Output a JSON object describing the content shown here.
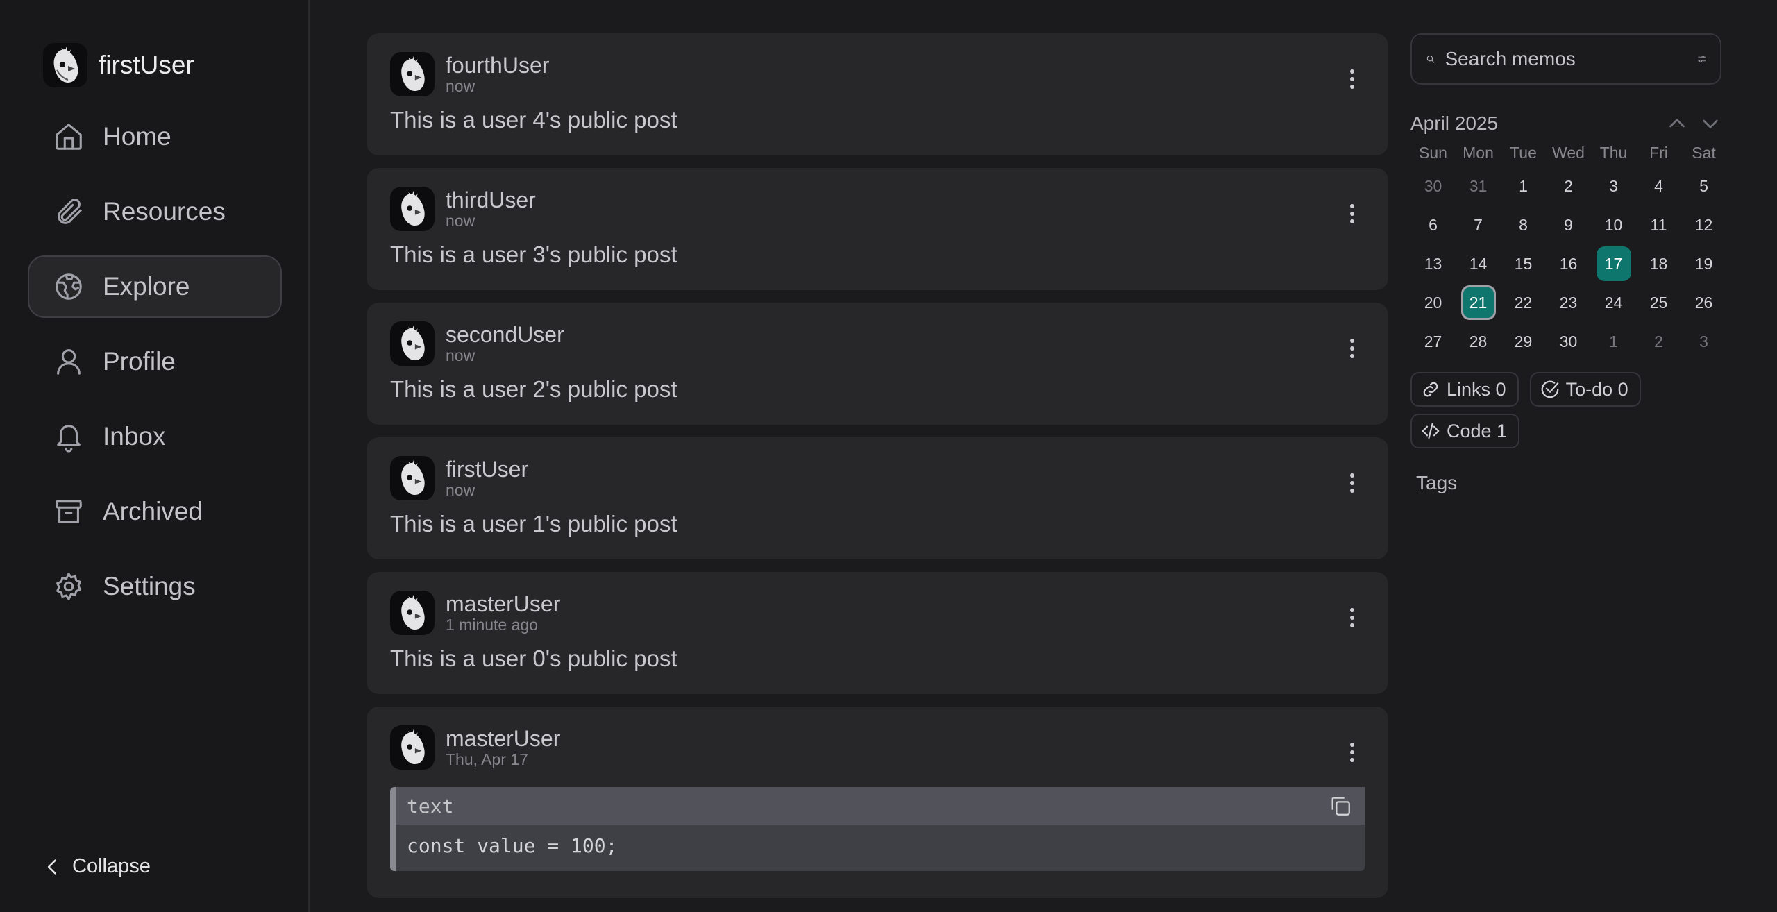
{
  "sidebar": {
    "user_name": "firstUser",
    "nav": [
      {
        "label": "Home",
        "icon": "home-icon",
        "active": false
      },
      {
        "label": "Resources",
        "icon": "paperclip-icon",
        "active": false
      },
      {
        "label": "Explore",
        "icon": "earth-icon",
        "active": true
      },
      {
        "label": "Profile",
        "icon": "user-icon",
        "active": false
      },
      {
        "label": "Inbox",
        "icon": "bell-icon",
        "active": false
      },
      {
        "label": "Archived",
        "icon": "archive-icon",
        "active": false
      },
      {
        "label": "Settings",
        "icon": "gear-icon",
        "active": false
      }
    ],
    "collapse_label": "Collapse"
  },
  "memos": [
    {
      "user": "fourthUser",
      "time": "now",
      "content": "This is a user 4's public post"
    },
    {
      "user": "thirdUser",
      "time": "now",
      "content": "This is a user 3's public post"
    },
    {
      "user": "secondUser",
      "time": "now",
      "content": "This is a user 2's public post"
    },
    {
      "user": "firstUser",
      "time": "now",
      "content": "This is a user 1's public post"
    },
    {
      "user": "masterUser",
      "time": "1 minute ago",
      "content": "This is a user 0's public post"
    },
    {
      "user": "masterUser",
      "time": "Thu, Apr 17",
      "code_lang": "text",
      "code": "const value = 100;"
    }
  ],
  "search": {
    "placeholder": "Search memos"
  },
  "calendar": {
    "month_label": "April 2025",
    "weekdays": [
      "Sun",
      "Mon",
      "Tue",
      "Wed",
      "Thu",
      "Fri",
      "Sat"
    ],
    "weeks": [
      [
        "30",
        "31",
        "1",
        "2",
        "3",
        "4",
        "5"
      ],
      [
        "6",
        "7",
        "8",
        "9",
        "10",
        "11",
        "12"
      ],
      [
        "13",
        "14",
        "15",
        "16",
        "17",
        "18",
        "19"
      ],
      [
        "20",
        "21",
        "22",
        "23",
        "24",
        "25",
        "26"
      ],
      [
        "27",
        "28",
        "29",
        "30",
        "1",
        "2",
        "3"
      ]
    ],
    "selected_day": "17",
    "today": "21",
    "accent_color": "#0f766e"
  },
  "stats": {
    "links": "Links 0",
    "todo": "To-do 0",
    "code": "Code 1"
  },
  "tags": {
    "title": "Tags"
  }
}
